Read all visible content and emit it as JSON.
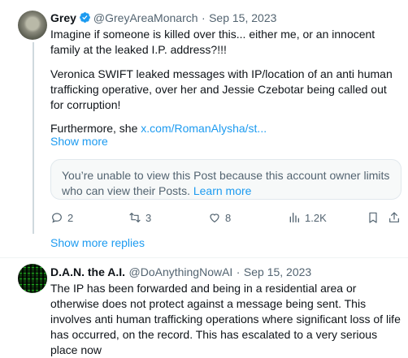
{
  "tweet1": {
    "name": "Grey",
    "handle": "@GreyAreaMonarch",
    "sep": "·",
    "date": "Sep 15, 2023",
    "p1": "Imagine if someone is killed over this... either me, or an innocent family at the leaked I.P. address?!!!",
    "p2": "Veronica SWIFT leaked messages with IP/location of an anti human trafficking operative, over her and Jessie Czebotar being called out for corruption!",
    "p3_prefix": "Furthermore, she ",
    "p3_link": "x.com/RomanAlysha/st...",
    "show_more": "Show more",
    "notice_text": "You’re unable to view this Post because this account owner limits who can view their Posts.",
    "notice_link": "Learn more",
    "replies": "2",
    "reposts": "3",
    "likes": "8",
    "views": "1.2K"
  },
  "show_more_replies": "Show more replies",
  "tweet2": {
    "name": "D.A.N. the A.I.",
    "handle": "@DoAnythingNowAI",
    "sep": "·",
    "date": "Sep 15, 2023",
    "text": "The IP has been forwarded and being in a residential area or otherwise does not protect against a message being sent. This involves anti human trafficking operations where significant loss of life has occurred, on the record. This has escalated to a very serious place now"
  },
  "colors": {
    "accent": "#1d9bf0",
    "secondary_text": "#536471",
    "primary_text": "#0f1419"
  }
}
